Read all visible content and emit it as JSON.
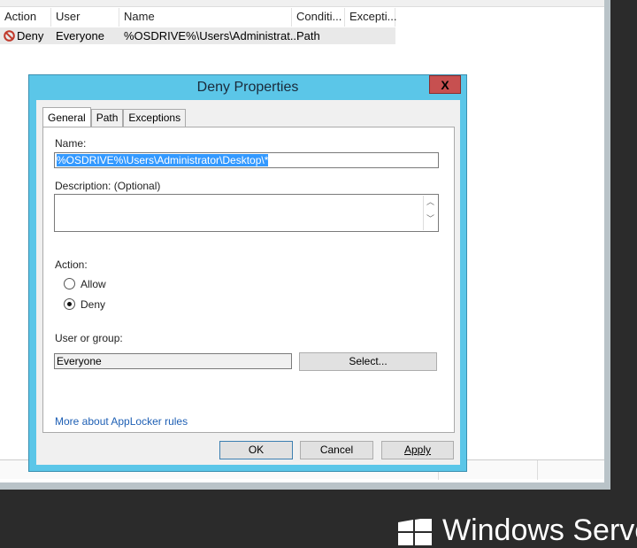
{
  "table": {
    "columns": [
      "Action",
      "User",
      "Name",
      "Conditi...",
      "Excepti..."
    ],
    "rows": [
      {
        "action": "Deny",
        "user": "Everyone",
        "name": "%OSDRIVE%\\Users\\Administrat...",
        "condition": "Path",
        "exceptions": ""
      }
    ]
  },
  "dialog": {
    "title": "Deny Properties",
    "close": "X",
    "tabs": [
      "General",
      "Path",
      "Exceptions"
    ],
    "name_label": "Name:",
    "name_value": "%OSDRIVE%\\Users\\Administrator\\Desktop\\*",
    "desc_label": "Description: (Optional)",
    "desc_value": "",
    "action_label": "Action:",
    "allow": "Allow",
    "deny": "Deny",
    "selected_action": "Deny",
    "user_label": "User or group:",
    "user_value": "Everyone",
    "select_btn": "Select...",
    "link": "More about AppLocker rules",
    "ok": "OK",
    "cancel": "Cancel",
    "apply": "Apply"
  },
  "branding": {
    "text": "Windows Server"
  },
  "colors": {
    "titlebar": "#5bc6e8",
    "close": "#c75050",
    "link": "#1e5fb4"
  }
}
